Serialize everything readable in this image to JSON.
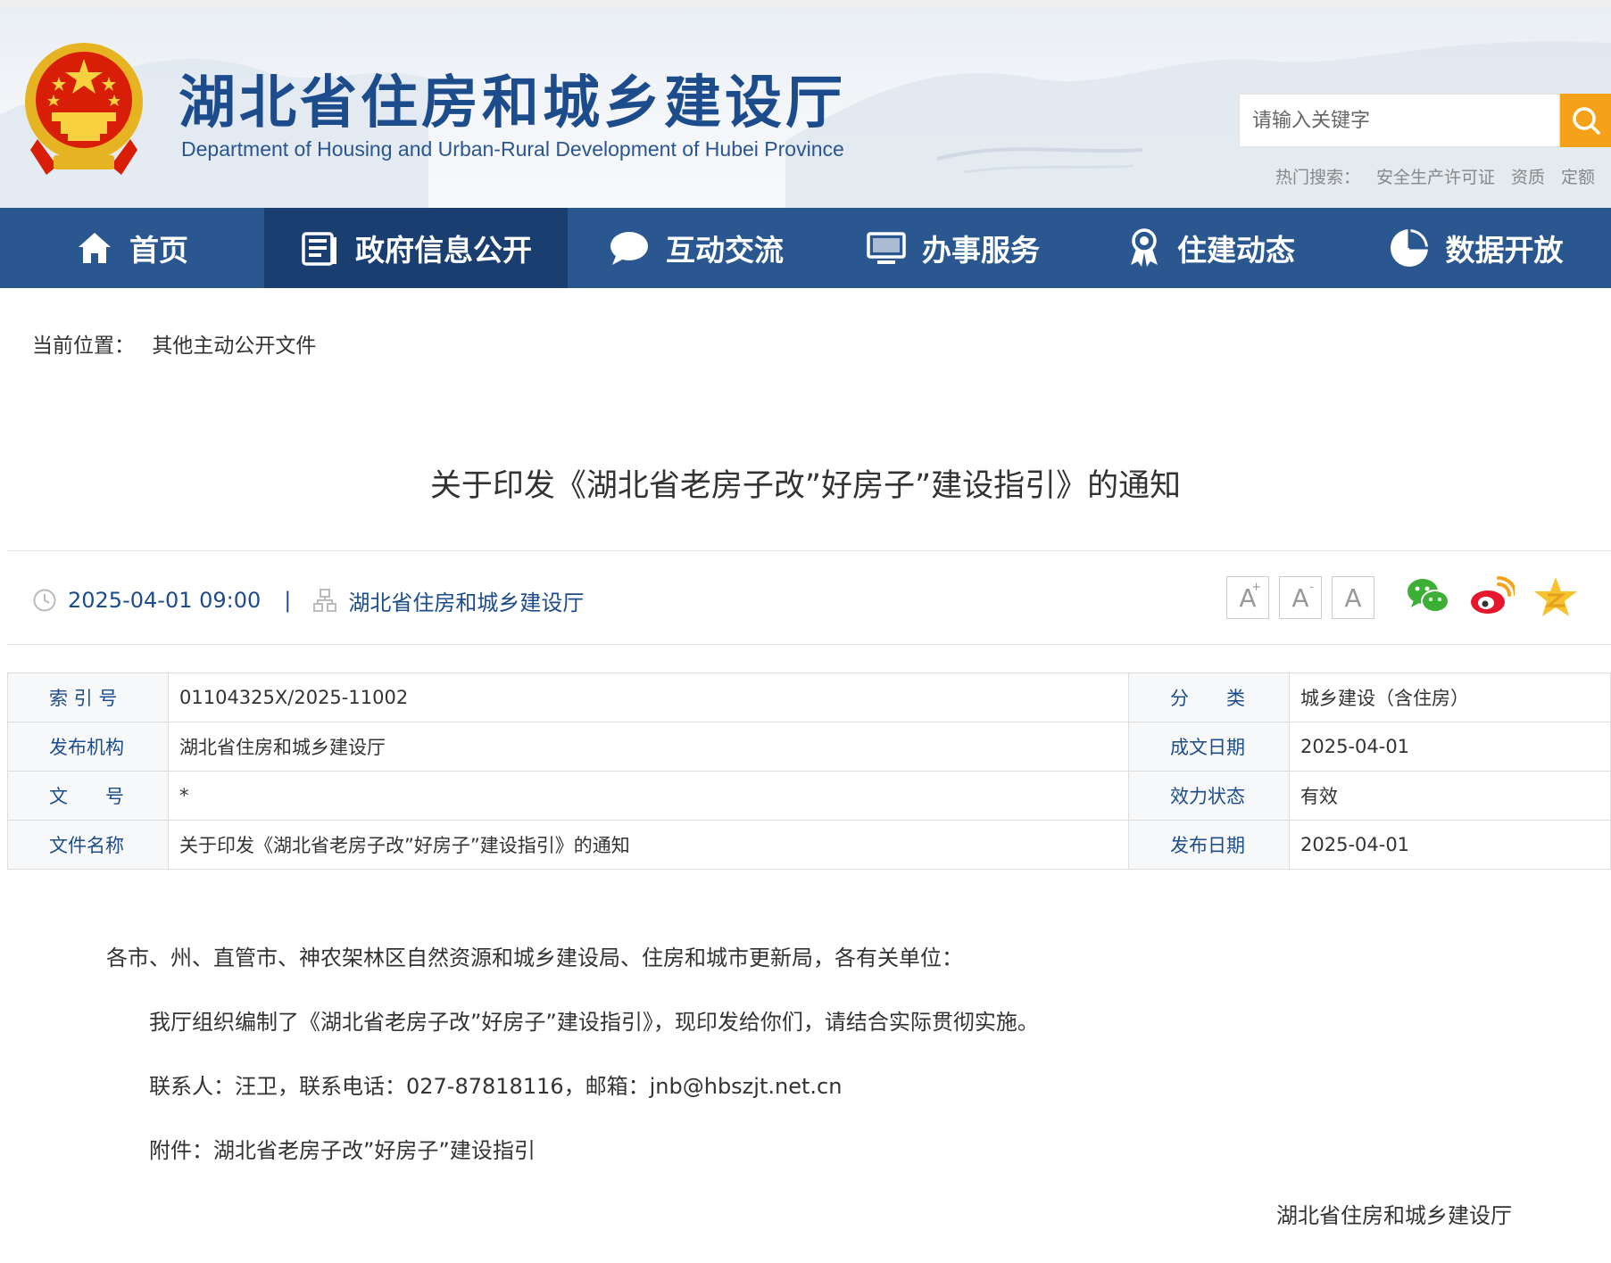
{
  "site": {
    "title": "湖北省住房和城乡建设厅",
    "subtitle": "Department of Housing and Urban-Rural Development of Hubei Province"
  },
  "search": {
    "placeholder": "请输入关键字",
    "hot_label": "热门搜索：",
    "hot_terms": [
      "安全生产许可证",
      "资质",
      "定额"
    ]
  },
  "nav": [
    {
      "label": "首页",
      "icon": "home-icon"
    },
    {
      "label": "政府信息公开",
      "icon": "document-icon"
    },
    {
      "label": "互动交流",
      "icon": "chat-bubble-icon"
    },
    {
      "label": "办事服务",
      "icon": "monitor-icon"
    },
    {
      "label": "住建动态",
      "icon": "award-ribbon-icon"
    },
    {
      "label": "数据开放",
      "icon": "pie-chart-icon"
    }
  ],
  "nav_active_index": 1,
  "breadcrumb": {
    "label": "当前位置：",
    "current": "其他主动公开文件"
  },
  "article": {
    "title": "关于印发《湖北省老房子改”好房子”建设指引》的通知",
    "datetime": "2025-04-01 09:00",
    "separator": "|",
    "source": "湖北省住房和城乡建设厅"
  },
  "font_controls": {
    "increase": "A",
    "increase_mark": "+",
    "decrease": "A",
    "decrease_mark": "-",
    "reset": "A"
  },
  "share_icons": [
    "wechat-icon",
    "weibo-icon",
    "qzone-icon"
  ],
  "colors": {
    "brand_blue": "#2b5790",
    "nav_active": "#1a3e6f",
    "search_button": "#f5a21a",
    "label_blue": "#1d4c8c"
  },
  "info_table": {
    "rows": [
      {
        "k1": "索 引 号",
        "v1": "01104325X/2025-11002",
        "k2": "分　　类",
        "v2": "城乡建设（含住房）"
      },
      {
        "k1": "发布机构",
        "v1": "湖北省住房和城乡建设厅",
        "k2": "成文日期",
        "v2": "2025-04-01"
      },
      {
        "k1": "文　　号",
        "v1": "*",
        "k2": "效力状态",
        "v2": "有效"
      },
      {
        "k1": "文件名称",
        "v1": "关于印发《湖北省老房子改”好房子”建设指引》的通知",
        "k2": "发布日期",
        "v2": "2025-04-01"
      }
    ]
  },
  "body": {
    "salutation": "各市、州、直管市、神农架林区自然资源和城乡建设局、住房和城市更新局，各有关单位：",
    "paragraphs": [
      "我厅组织编制了《湖北省老房子改”好房子”建设指引》，现印发给你们，请结合实际贯彻实施。",
      "联系人：汪卫，联系电话：027-87818116，邮箱：jnb@hbszjt.net.cn",
      "附件：湖北省老房子改”好房子”建设指引"
    ],
    "signature": "湖北省住房和城乡建设厅"
  }
}
